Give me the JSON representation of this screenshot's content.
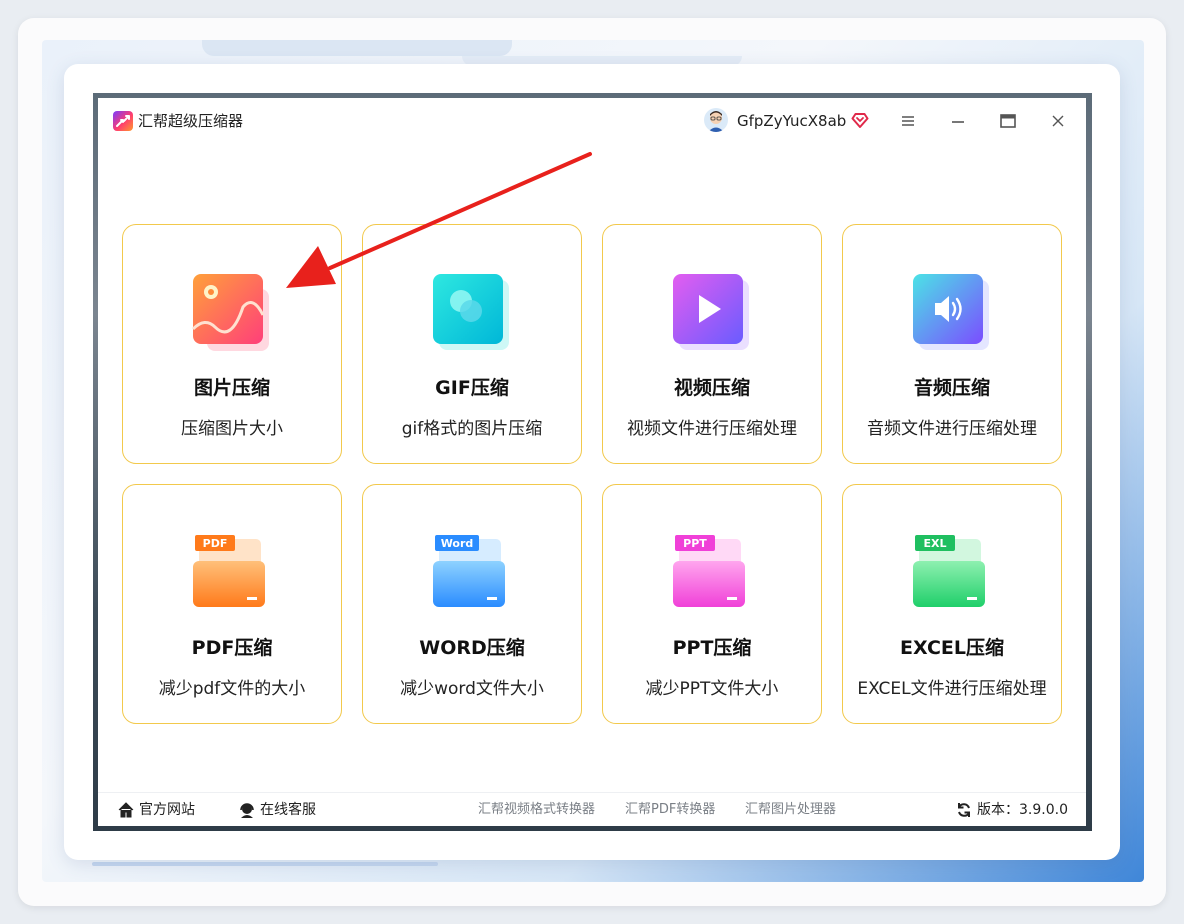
{
  "window": {
    "app_title": "汇帮超级压缩器",
    "username": "GfpZyYucX8ab",
    "icons": [
      "app-logo-icon",
      "avatar",
      "vip-heart-icon",
      "menu-icon",
      "minimize-icon",
      "maximize-icon",
      "close-icon"
    ]
  },
  "tiles": [
    {
      "title": "图片压缩",
      "desc": "压缩图片大小",
      "icon": "image-icon"
    },
    {
      "title": "GIF压缩",
      "desc": "gif格式的图片压缩",
      "icon": "gif-icon"
    },
    {
      "title": "视频压缩",
      "desc": "视频文件进行压缩处理",
      "icon": "video-play-icon"
    },
    {
      "title": "音频压缩",
      "desc": "音频文件进行压缩处理",
      "icon": "speaker-icon"
    },
    {
      "title": "PDF压缩",
      "desc": "减少pdf文件的大小",
      "icon": "pdf-folder-icon",
      "badge": "PDF"
    },
    {
      "title": "WORD压缩",
      "desc": "减少word文件大小",
      "icon": "word-folder-icon",
      "badge": "Word"
    },
    {
      "title": "PPT压缩",
      "desc": "减少PPT文件大小",
      "icon": "ppt-folder-icon",
      "badge": "PPT"
    },
    {
      "title": "EXCEL压缩",
      "desc": "EXCEL文件进行压缩处理",
      "icon": "excel-folder-icon",
      "badge": "EXL"
    }
  ],
  "footer": {
    "website": "官方网站",
    "support": "在线客服",
    "links": [
      "汇帮视频格式转换器",
      "汇帮PDF转换器",
      "汇帮图片处理器"
    ],
    "version": "版本：3.9.0.0"
  },
  "colors": {
    "tile_border": "#f2c94c",
    "arrow": "#e8211c"
  }
}
